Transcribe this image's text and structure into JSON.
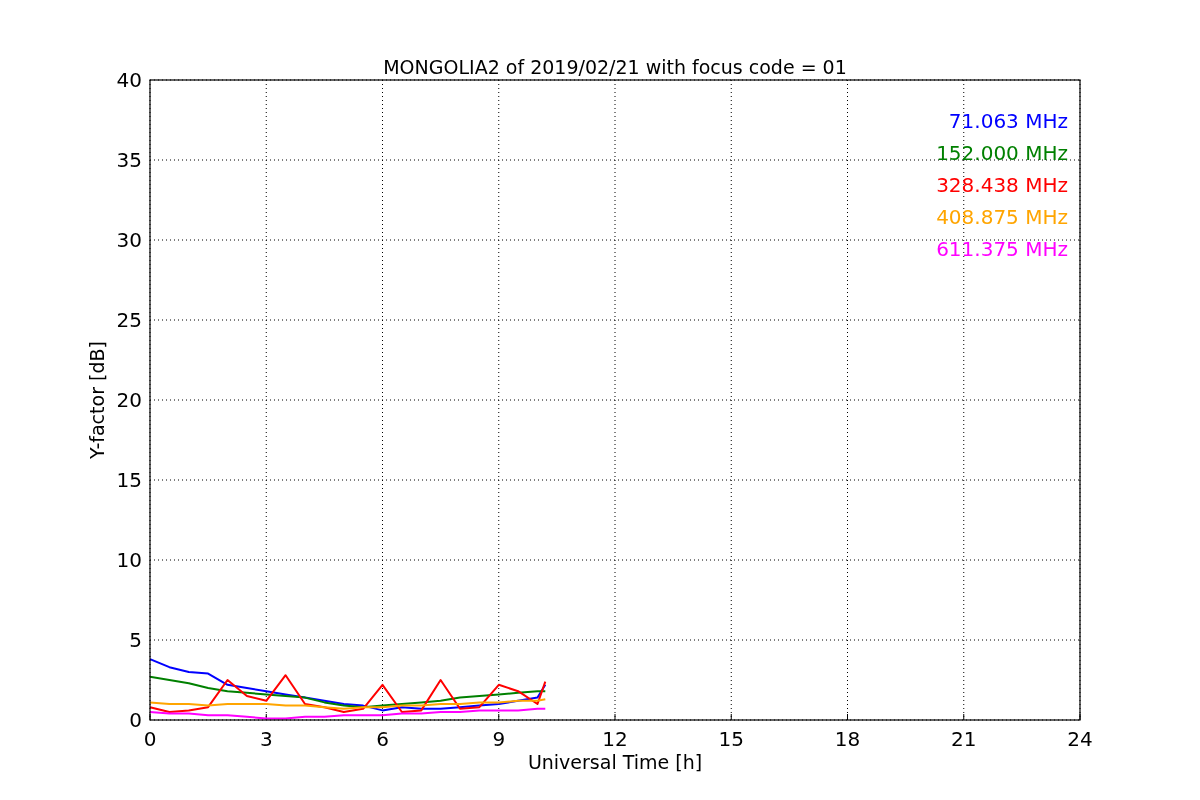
{
  "chart_data": {
    "type": "line",
    "title": "MONGOLIA2 of 2019/02/21 with focus code = 01",
    "xlabel": "Universal Time [h]",
    "ylabel": "Y-factor [dB]",
    "x": [
      0,
      0.5,
      1,
      1.5,
      2,
      2.5,
      3,
      3.5,
      4,
      4.5,
      5,
      5.5,
      6,
      6.5,
      7,
      7.5,
      8,
      8.5,
      9,
      9.5,
      10,
      10.2
    ],
    "series": [
      {
        "name": "71.063 MHz",
        "color": "#0000ff",
        "values": [
          3.8,
          3.3,
          3.0,
          2.9,
          2.2,
          2.0,
          1.8,
          1.6,
          1.4,
          1.2,
          1.0,
          0.9,
          0.6,
          0.8,
          0.7,
          0.7,
          0.8,
          0.9,
          1.0,
          1.2,
          1.4,
          2.2
        ]
      },
      {
        "name": "152.000 MHz",
        "color": "#008000",
        "values": [
          2.7,
          2.5,
          2.3,
          2.0,
          1.8,
          1.7,
          1.6,
          1.5,
          1.4,
          1.1,
          0.9,
          0.8,
          0.9,
          1.0,
          1.1,
          1.2,
          1.4,
          1.5,
          1.6,
          1.7,
          1.8,
          1.8
        ]
      },
      {
        "name": "328.438 MHz",
        "color": "#ff0000",
        "values": [
          0.8,
          0.5,
          0.6,
          0.8,
          2.5,
          1.5,
          1.2,
          2.8,
          1.0,
          0.8,
          0.5,
          0.7,
          2.2,
          0.5,
          0.6,
          2.5,
          0.7,
          0.8,
          2.2,
          1.8,
          1.0,
          2.4
        ]
      },
      {
        "name": "408.875 MHz",
        "color": "#ffa500",
        "values": [
          1.1,
          1.0,
          1.0,
          0.9,
          1.0,
          1.0,
          1.0,
          0.9,
          0.9,
          0.8,
          0.7,
          0.8,
          0.8,
          0.9,
          0.9,
          1.0,
          1.0,
          1.1,
          1.1,
          1.2,
          1.2,
          1.3
        ]
      },
      {
        "name": "611.375 MHz",
        "color": "#ff00ff",
        "values": [
          0.5,
          0.4,
          0.4,
          0.3,
          0.3,
          0.2,
          0.1,
          0.1,
          0.2,
          0.2,
          0.3,
          0.3,
          0.3,
          0.4,
          0.4,
          0.5,
          0.5,
          0.6,
          0.6,
          0.6,
          0.7,
          0.7
        ]
      }
    ],
    "grid": true,
    "xlim": [
      0,
      24
    ],
    "ylim": [
      0,
      40
    ],
    "xticks": [
      0,
      3,
      6,
      9,
      12,
      15,
      18,
      21,
      24
    ],
    "yticks": [
      0,
      5,
      10,
      15,
      20,
      25,
      30,
      35,
      40
    ]
  }
}
